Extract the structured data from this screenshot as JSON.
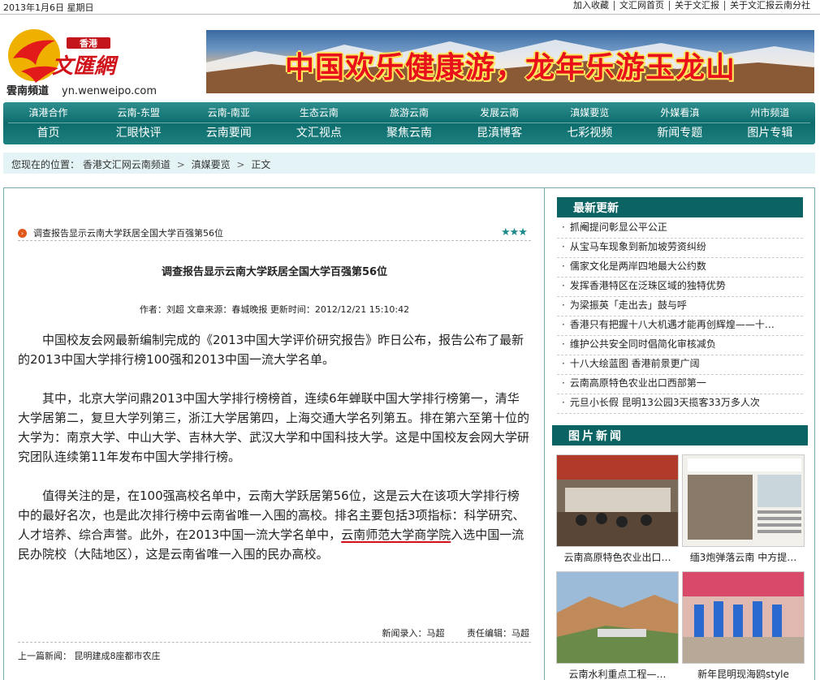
{
  "topbar": {
    "date": "2013年1月6日  星期日",
    "links": [
      "加入收藏",
      "文汇网首页",
      "关于文汇报",
      "关于文汇报云南分社"
    ]
  },
  "logo": {
    "hk": "香港",
    "name": "文匯網",
    "channel": "雲南頻道",
    "url": "yn.wenweipo.com"
  },
  "banner": {
    "text": "中国欢乐健康游，龙年乐游玉龙山"
  },
  "nav": {
    "row1": [
      "滇港合作",
      "云南-东盟",
      "云南-南亚",
      "生态云南",
      "旅游云南",
      "发展云南",
      "滇媒要览",
      "外媒看滇",
      "州市频道"
    ],
    "row2": [
      "首页",
      "汇眼快评",
      "云南要闻",
      "文汇视点",
      "聚焦云南",
      "昆滇博客",
      "七彩视频",
      "新闻专题",
      "图片专辑"
    ]
  },
  "breadcrumb": {
    "label": "您现在的位置：",
    "items": [
      "香港文汇网云南频道",
      "滇媒要览",
      "正文"
    ],
    "sep": ">"
  },
  "article": {
    "list_title": "调查报告显示云南大学跃居全国大学百强第56位",
    "stars": "★★★",
    "title": "调查报告显示云南大学跃居全国大学百强第56位",
    "meta": "作者：刘超  文章来源：春城晚报  更新时间：2012/12/21 15:10:42",
    "p1": "中国校友会网最新编制完成的《2013中国大学评价研究报告》昨日公布，报告公布了最新的2013中国大学排行榜100强和2013中国一流大学名单。",
    "p2": "其中，北京大学问鼎2013中国大学排行榜榜首，连续6年蝉联中国大学排行榜第一，清华大学居第二，复旦大学列第三，浙江大学居第四，上海交通大学名列第五。排在第六至第十位的大学为：南京大学、中山大学、吉林大学、武汉大学和中国科技大学。这是中国校友会网大学研究团队连续第11年发布中国大学排行榜。",
    "p3a": "值得关注的是，在100强高校名单中，云南大学跃居第56位，这是云大在该项大学排行榜中的最好名次，也是此次排行榜中云南省唯一入围的高校。排名主要包括3项指标：科学研究、人才培养、综合声誉。此外，在2013中国一流大学名单中，",
    "p3_link": "云南师范大学商学院",
    "p3b": "入选中国一流民办院校（大陆地区），这是云南省唯一入围的民办高校。",
    "entry": "新闻录入：马超",
    "editor": "责任编辑：马超",
    "prev": "上一篇新闻：  昆明建成8座都市农庄"
  },
  "sidebar": {
    "latest_title": "最新更新",
    "latest": [
      "抓阉提问彰显公平公正",
      "从宝马车现象到新加坡劳资纠纷",
      "儒家文化是两岸四地最大公约数",
      "发挥香港特区在泛珠区域的独特优势",
      "为梁振英「走出去」鼓与呼",
      "香港只有把握十八大机遇才能再创辉煌——十…",
      "维护公共安全同时倡简化审核减负",
      "十八大绘蓝图 香港前景更广阔",
      "云南高原特色农业出口西部第一",
      "元旦小长假 昆明13公园3天揽客33万多人次"
    ],
    "pic_title": "图片新闻",
    "pics": [
      {
        "caption": "云南高原特色农业出口…"
      },
      {
        "caption": "缅3炮弹落云南 中方提…"
      },
      {
        "caption": "云南水利重点工程—…"
      },
      {
        "caption": "新年昆明现海鸥style"
      }
    ]
  },
  "colors": {
    "accent": "#0b6363",
    "nav": "#1e7f7f",
    "crumb_bg": "#e4f4f6",
    "underline": "#d0121b"
  }
}
